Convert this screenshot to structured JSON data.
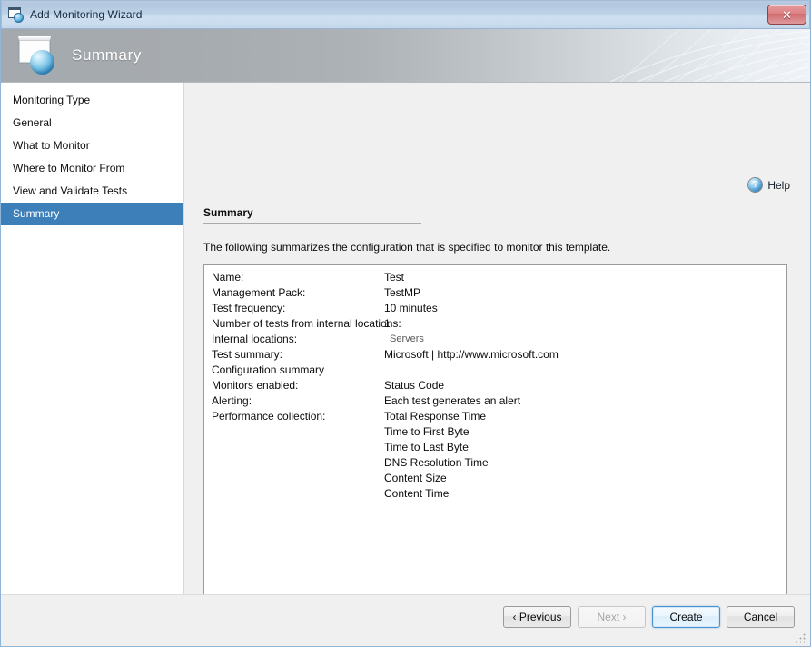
{
  "window": {
    "title": "Add Monitoring Wizard",
    "close_label": "✕",
    "accent_selected": "#3c7fb9",
    "titlebar_color": "#bdd1e6"
  },
  "banner": {
    "title": "Summary",
    "icon": "window-globe-icon"
  },
  "sidebar": {
    "items": [
      {
        "label": "Monitoring Type",
        "selected": false
      },
      {
        "label": "General",
        "selected": false
      },
      {
        "label": "What to Monitor",
        "selected": false
      },
      {
        "label": "Where to Monitor From",
        "selected": false
      },
      {
        "label": "View and Validate Tests",
        "selected": false
      },
      {
        "label": "Summary",
        "selected": true
      }
    ]
  },
  "content": {
    "help_label": "Help",
    "help_icon": "?",
    "heading": "Summary",
    "description": "The following summarizes the configuration that is specified to monitor this template.",
    "rows": [
      {
        "label": "Name:",
        "value": "Test",
        "style": "normal"
      },
      {
        "label": "Management Pack:",
        "value": "TestMP",
        "style": "normal"
      },
      {
        "label": "Test frequency:",
        "value": "10 minutes",
        "style": "normal"
      },
      {
        "label": "Number of tests from internal locations:",
        "value": "1",
        "style": "normal"
      },
      {
        "label": "Internal locations:",
        "value": "Servers",
        "style": "sub"
      },
      {
        "label": "Test summary:",
        "value": "Microsoft | http://www.microsoft.com",
        "style": "normal"
      },
      {
        "label": "Configuration summary",
        "value": "",
        "style": "header"
      },
      {
        "label": "Monitors enabled:",
        "value": "Status Code",
        "style": "normal"
      },
      {
        "label": "Alerting:",
        "value": "Each test generates an alert",
        "style": "normal"
      },
      {
        "label": "Performance collection:",
        "value": "Total Response Time",
        "style": "normal"
      },
      {
        "label": "",
        "value": "Time to First Byte",
        "style": "normal"
      },
      {
        "label": "",
        "value": "Time to Last Byte",
        "style": "normal"
      },
      {
        "label": "",
        "value": "DNS Resolution Time",
        "style": "normal"
      },
      {
        "label": "",
        "value": "Content Size",
        "style": "normal"
      },
      {
        "label": "",
        "value": "Content Time",
        "style": "normal"
      }
    ],
    "scrollbar": {
      "left_arrow": "◀",
      "right_arrow": "▶",
      "orientation": "horizontal"
    }
  },
  "footer": {
    "buttons": [
      {
        "name": "previous",
        "prefix": "‹ ",
        "accel": "P",
        "rest": "revious",
        "suffix": "",
        "state": "enabled"
      },
      {
        "name": "next",
        "prefix": "",
        "accel": "N",
        "rest": "ext",
        "suffix": " ›",
        "state": "disabled"
      },
      {
        "name": "create",
        "prefix": "Cr",
        "accel": "e",
        "rest": "ate",
        "suffix": "",
        "state": "default"
      },
      {
        "name": "cancel",
        "prefix": "Cancel",
        "accel": "",
        "rest": "",
        "suffix": "",
        "state": "enabled"
      }
    ]
  }
}
